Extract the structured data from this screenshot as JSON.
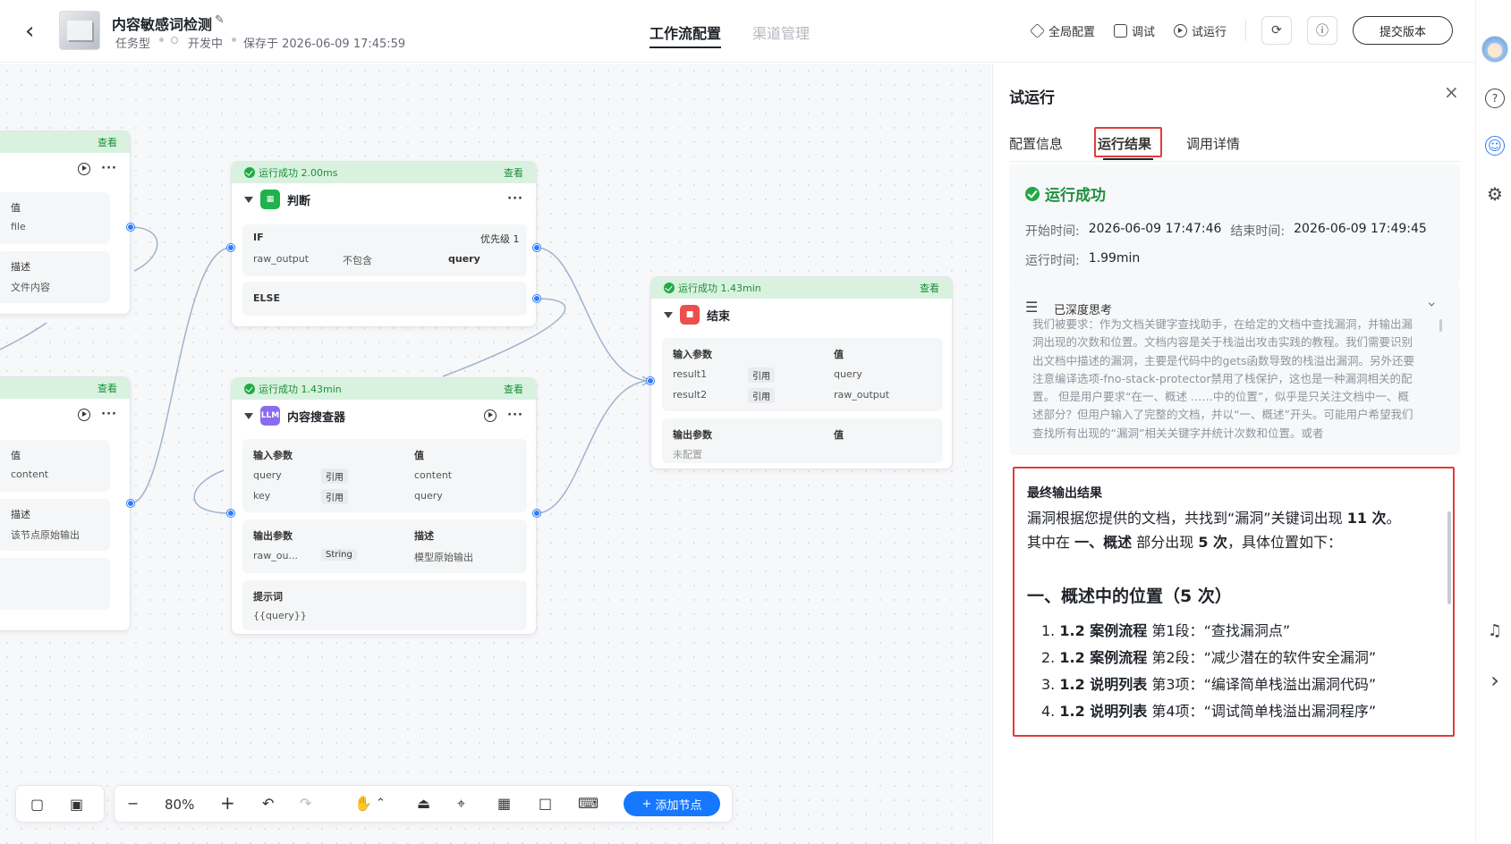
{
  "header": {
    "back_icon": "←",
    "title": "内容敏感词检测",
    "edit_icon": "✎",
    "type_label": "任务型",
    "status_label": "开发中",
    "saved_label": "保存于 2026-06-09 17:45:59",
    "tabs": [
      {
        "label": "工作流配置",
        "active": true
      },
      {
        "label": "渠道管理",
        "active": false
      }
    ],
    "actions": {
      "global_config": "全局配置",
      "debug": "调试",
      "trial_run": "试运行"
    },
    "submit_label": "提交版本"
  },
  "canvas": {
    "left_node_top": {
      "view": "查看",
      "value_header": "值",
      "value": "file",
      "desc_header": "描述",
      "desc": "文件内容"
    },
    "left_node_bottom": {
      "view": "查看",
      "value_header": "值",
      "value": "content",
      "desc_header": "描述",
      "desc": "该节点原始输出"
    },
    "judge_node": {
      "status": "运行成功 2.00ms",
      "view": "查看",
      "title": "判断",
      "if_label": "IF",
      "priority": "优先级 1",
      "var": "raw_output",
      "op": "不包含",
      "target": "query",
      "else_label": "ELSE"
    },
    "search_node": {
      "status": "运行成功 1.43min",
      "view": "查看",
      "icon_text": "LLM",
      "title": "内容搜查器",
      "input_header": "输入参数",
      "value_header": "值",
      "inputs": [
        {
          "name": "query",
          "type": "引用",
          "value": "content"
        },
        {
          "name": "key",
          "type": "引用",
          "value": "query"
        }
      ],
      "output_header": "输出参数",
      "desc_header": "描述",
      "output_name": "raw_ou...",
      "output_type": "String",
      "output_desc": "模型原始输出",
      "prompt_header": "提示词",
      "prompt_value": "{{query}}"
    },
    "end_node": {
      "status": "运行成功 1.43min",
      "view": "查看",
      "title": "结束",
      "input_header": "输入参数",
      "value_header": "值",
      "inputs": [
        {
          "name": "result1",
          "type": "引用",
          "value": "query"
        },
        {
          "name": "result2",
          "type": "引用",
          "value": "raw_output"
        }
      ],
      "output_header": "输出参数",
      "output_value_header": "值",
      "output_empty": "未配置"
    }
  },
  "toolbar": {
    "zoom": "80%",
    "minus": "−",
    "plus": "+",
    "add_node": "添加节点"
  },
  "panel": {
    "title": "试运行",
    "close": "×",
    "tabs": [
      {
        "label": "配置信息",
        "active": false
      },
      {
        "label": "运行结果",
        "active": true
      },
      {
        "label": "调用详情",
        "active": false
      }
    ],
    "status": "运行成功",
    "start_label": "开始时间:",
    "start_value": "2026-06-09 17:47:46",
    "end_label": "结束时间:",
    "end_value": "2026-06-09 17:49:45",
    "duration_label": "运行时间:",
    "duration_value": "1.99min",
    "think_title": "已深度思考",
    "think_text": "我们被要求：作为文档关键字查找助手，在给定的文档中查找漏洞，并输出漏洞出现的次数和位置。文档内容是关于栈溢出攻击实践的教程。我们需要识别出文档中描述的漏洞，主要是代码中的gets函数导致的栈溢出漏洞。另外还要注意编译选项-fno-stack-protector禁用了栈保护，这也是一种漏洞相关的配置。 但是用户要求“在一、概述 ……中的位置”，似乎是只关注文档中一、概述部分？但用户输入了完整的文档，并以“一、概述”开头。可能用户希望我们查找所有出现的“漏洞”相关关键字并统计次数和位置。或者",
    "final_title": "最终输出结果",
    "final_intro_1": "漏洞根据您提供的文档，共找到“漏洞”关键词出现",
    "final_count": "11 次",
    "final_intro_2": "。",
    "final_intro_3": "其中在",
    "final_section": "一、概述",
    "final_intro_4": "部分出现",
    "final_section_count": "5 次",
    "final_intro_5": "，具体位置如下：",
    "final_heading": "一、概述中的位置（5 次）",
    "items": [
      {
        "no": "1.",
        "sec": "1.2 案例流程",
        "pos": "第1段：",
        "quote": "“查找漏洞点”"
      },
      {
        "no": "2.",
        "sec": "1.2 案例流程",
        "pos": "第2段：",
        "quote": "“减少潜在的软件安全漏洞”"
      },
      {
        "no": "3.",
        "sec": "1.2 说明列表",
        "pos": "第3项：",
        "quote": "“编译简单栈溢出漏洞代码”"
      },
      {
        "no": "4.",
        "sec": "1.2 说明列表",
        "pos": "第4项：",
        "quote": "“调试简单栈溢出漏洞程序”"
      }
    ]
  },
  "rail": {
    "help": "?",
    "smile": "☺",
    "gear": "⚙",
    "headset": "♫",
    "chevron": "›"
  },
  "colors": {
    "accent": "#1677ff",
    "success": "#22a845",
    "highlight": "#e23b3b"
  }
}
